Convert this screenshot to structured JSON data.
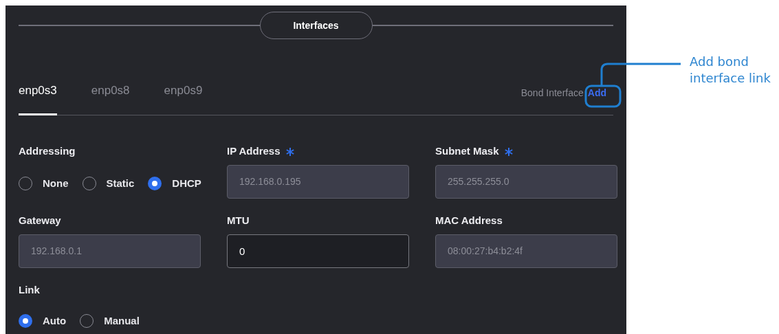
{
  "section_title": "Interfaces",
  "tabs": [
    {
      "label": "enp0s3",
      "selected": true
    },
    {
      "label": "enp0s8",
      "selected": false
    },
    {
      "label": "enp0s9",
      "selected": false
    }
  ],
  "bond_interface": {
    "label": "Bond Interface",
    "link": "Add"
  },
  "fields": [
    {
      "kind": "radio",
      "label": "Addressing",
      "options": [
        {
          "label": "None",
          "selected": false
        },
        {
          "label": "Static",
          "selected": false
        },
        {
          "label": "DHCP",
          "selected": true
        }
      ]
    },
    {
      "kind": "input",
      "label": "IP Address",
      "required": true,
      "value": "192.168.0.195",
      "disabled": true
    },
    {
      "kind": "input",
      "label": "Subnet Mask",
      "required": true,
      "value": "255.255.255.0",
      "disabled": true
    },
    {
      "kind": "input",
      "label": "Gateway",
      "required": false,
      "value": "192.168.0.1",
      "disabled": true
    },
    {
      "kind": "input",
      "label": "MTU",
      "required": false,
      "value": "0",
      "disabled": false
    },
    {
      "kind": "input",
      "label": "MAC Address",
      "required": false,
      "value": "08:00:27:b4:b2:4f",
      "disabled": true
    },
    {
      "kind": "radio",
      "label": "Link",
      "options": [
        {
          "label": "Auto",
          "selected": true
        },
        {
          "label": "Manual",
          "selected": false
        }
      ]
    }
  ],
  "callout": {
    "text": "Add bond interface link"
  }
}
